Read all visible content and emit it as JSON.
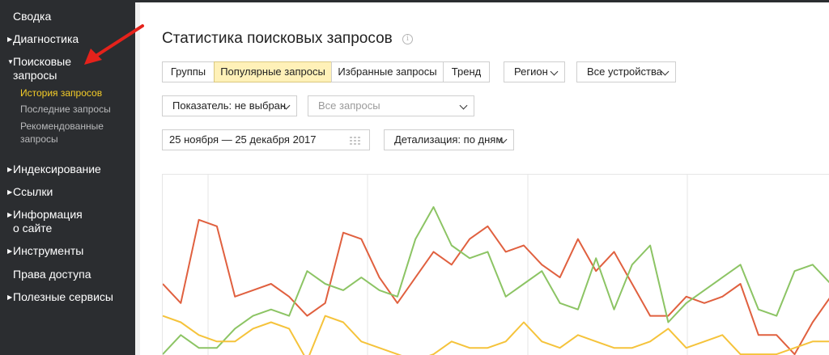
{
  "sidebar": {
    "items": [
      {
        "label": "Сводка",
        "has_arrow": false
      },
      {
        "label": "Диагностика",
        "has_arrow": true
      },
      {
        "label_line1": "Поисковые",
        "label_line2": "запросы",
        "has_arrow": true,
        "expanded": true
      },
      {
        "label": "Индексирование",
        "has_arrow": true
      },
      {
        "label": "Ссылки",
        "has_arrow": true
      },
      {
        "label_line1": "Информация",
        "label_line2": "о сайте",
        "has_arrow": true
      },
      {
        "label": "Инструменты",
        "has_arrow": true
      },
      {
        "label": "Права доступа",
        "has_arrow": false
      },
      {
        "label": "Полезные сервисы",
        "has_arrow": true
      }
    ],
    "subitems": [
      {
        "label": "История запросов",
        "active": true
      },
      {
        "label": "Последние запросы",
        "active": false
      },
      {
        "label_line1": "Рекомендованные",
        "label_line2": "запросы",
        "active": false
      }
    ]
  },
  "header": {
    "title": "Статистика поисковых запросов",
    "info_icon": "info-icon"
  },
  "tabs": [
    {
      "label": "Группы",
      "active": false
    },
    {
      "label": "Популярные запросы",
      "active": true
    },
    {
      "label": "Избранные запросы",
      "active": false
    },
    {
      "label": "Тренд",
      "active": false
    }
  ],
  "filters": {
    "region": "Регион",
    "devices": "Все устройства",
    "indicator": "Показатель: не выбран",
    "queries_placeholder": "Все запросы",
    "date_range": "25 ноября — 25 декабря 2017",
    "detail": "Детализация: по дням"
  },
  "colors": {
    "sidebar_bg": "#2b2d30",
    "active_sub": "#f5cd28",
    "active_tab": "#fff1b8",
    "series_red": "#e0603f",
    "series_green": "#8cc464",
    "series_yellow": "#f5c33b",
    "annotation_arrow": "#e5221b"
  },
  "chart_data": {
    "type": "line",
    "series": [
      {
        "color": "#e0603f",
        "values": [
          12,
          9,
          22,
          21,
          10,
          11,
          12,
          10,
          7,
          9,
          20,
          19,
          13,
          9,
          13,
          17,
          15,
          19,
          21,
          17,
          18,
          15,
          13,
          19,
          14,
          17,
          12,
          7,
          7,
          10,
          9,
          10,
          12,
          4,
          4,
          1,
          6,
          10
        ]
      },
      {
        "color": "#8cc464",
        "values": [
          1,
          4,
          2,
          2,
          5,
          7,
          8,
          7,
          14,
          12,
          11,
          13,
          11,
          10,
          19,
          24,
          18,
          16,
          17,
          10,
          12,
          14,
          9,
          8,
          16,
          8,
          15,
          18,
          6,
          9,
          11,
          13,
          15,
          8,
          7,
          14,
          15,
          12
        ]
      },
      {
        "color": "#f5c33b",
        "values": [
          7,
          6,
          4,
          3,
          3,
          5,
          6,
          5,
          0,
          7,
          6,
          3,
          2,
          1,
          0,
          1,
          3,
          2,
          2,
          3,
          6,
          3,
          2,
          4,
          3,
          2,
          2,
          3,
          5,
          2,
          3,
          4,
          1,
          1,
          1,
          2,
          3,
          3
        ]
      }
    ]
  }
}
